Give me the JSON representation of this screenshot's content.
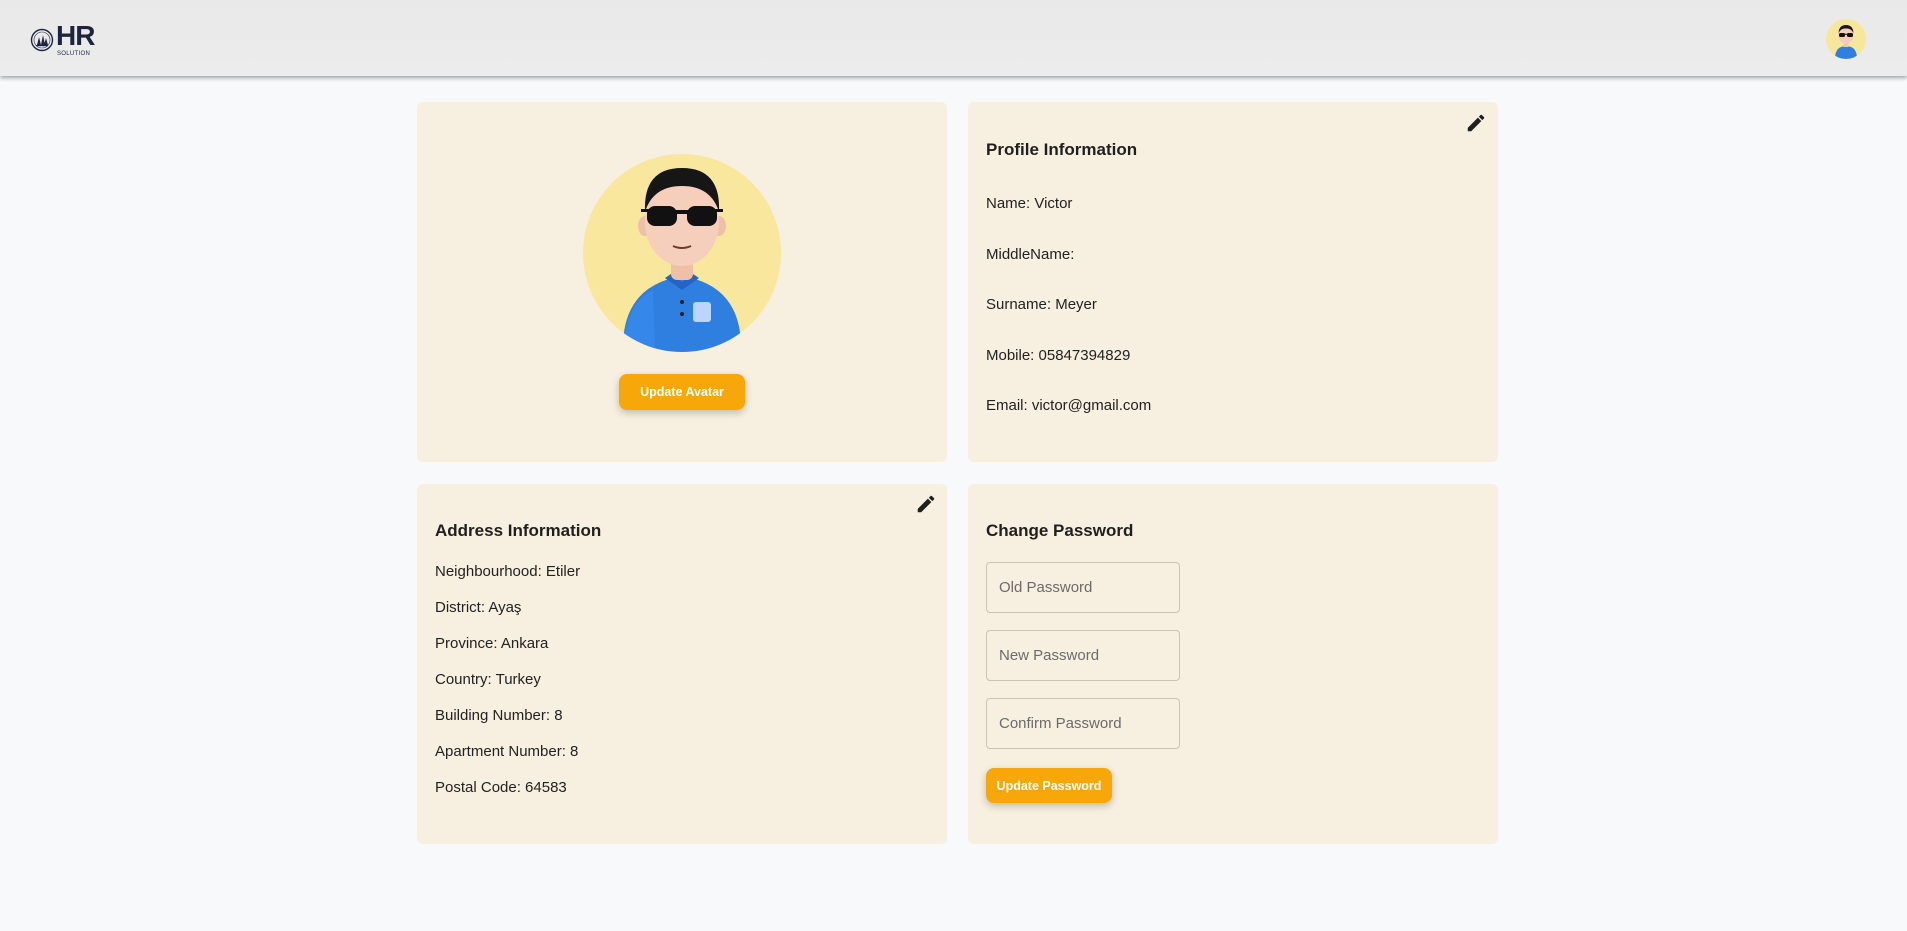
{
  "header": {
    "logo_text": "HR",
    "logo_subtext": "SOLUTION"
  },
  "avatar_card": {
    "update_button": "Update Avatar"
  },
  "profile": {
    "title": "Profile Information",
    "name": "Name: Victor",
    "middle_name": "MiddleName:",
    "surname": "Surname: Meyer",
    "mobile": "Mobile: 05847394829",
    "email": "Email: victor@gmail.com"
  },
  "address": {
    "title": "Address Information",
    "neighbourhood": "Neighbourhood: Etiler",
    "district": "District: Ayaş",
    "province": "Province: Ankara",
    "country": "Country: Turkey",
    "building": "Building Number: 8",
    "apartment": "Apartment Number: 8",
    "postal": "Postal Code: 64583"
  },
  "password": {
    "title": "Change Password",
    "old_placeholder": "Old Password",
    "new_placeholder": "New Password",
    "confirm_placeholder": "Confirm Password",
    "update_button": "Update Password"
  },
  "colors": {
    "accent": "#f7a70a",
    "card_bg": "#f7efdf",
    "avatar_bg": "#f8e79d",
    "page_bg": "#f8f9fb"
  },
  "icons": [
    "logo-icon",
    "user-avatar-icon",
    "edit-icon"
  ]
}
